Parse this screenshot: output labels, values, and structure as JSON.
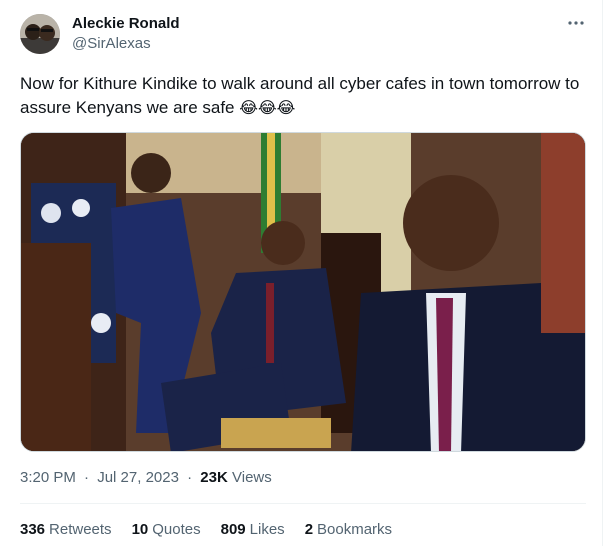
{
  "author": {
    "name": "Aleckie Ronald",
    "handle": "@SirAlexas"
  },
  "tweet": {
    "text": "Now for Kithure Kindike to walk around all cyber cafes in town tomorrow to assure Kenyans we are safe",
    "emojis": "😂😂😂"
  },
  "meta": {
    "time": "3:20 PM",
    "separator": "·",
    "date": "Jul 27, 2023",
    "views_count": "23K",
    "views_label": "Views"
  },
  "stats": {
    "retweets": {
      "count": "336",
      "label": "Retweets"
    },
    "quotes": {
      "count": "10",
      "label": "Quotes"
    },
    "likes": {
      "count": "809",
      "label": "Likes"
    },
    "bookmarks": {
      "count": "2",
      "label": "Bookmarks"
    }
  },
  "icons": {
    "more": "more-horizontal-icon"
  },
  "colors": {
    "text": "#0f1419",
    "secondary": "#536471",
    "border": "#eff3f4"
  }
}
